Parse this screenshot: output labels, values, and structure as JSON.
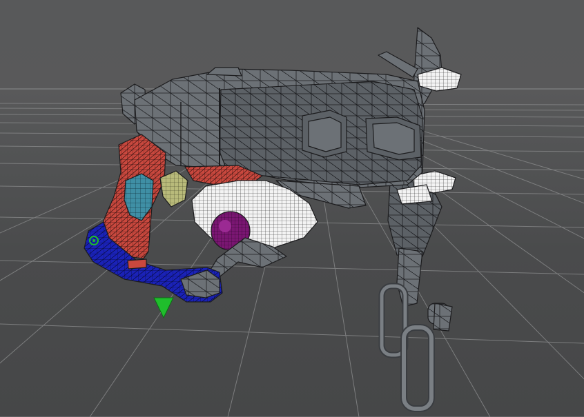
{
  "viewport": {
    "label": "",
    "colors": {
      "background_top": "#59595a",
      "background_bottom": "#464748",
      "grid_line": "#7d7e7f",
      "horizon_line": "#8c8d8e",
      "wire": "#1c1c1e",
      "metal": "#6c7176",
      "red_part": "#c9483e",
      "blue_part": "#1a22b8",
      "cyan_part": "#3f8fa5",
      "yellow_part": "#b8ba7a",
      "white_part": "#f1f1f1",
      "purple_part": "#7a1672",
      "gizmo_green": "#1fbe2c"
    },
    "icons": [
      "pivot-gizmo-icon",
      "pivot-point-icon"
    ]
  }
}
